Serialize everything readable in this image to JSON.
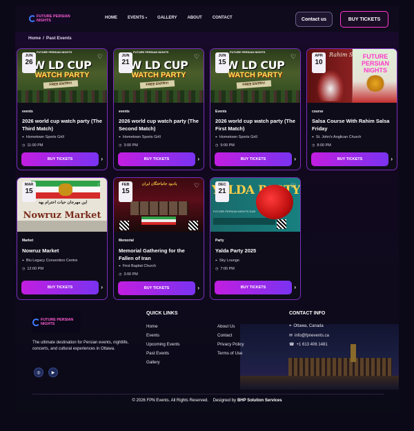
{
  "header": {
    "logo_text": "FUTURE PERSIAN NIGHTS",
    "nav": [
      {
        "label": "HOME",
        "active": false
      },
      {
        "label": "EVENTS",
        "active": true,
        "caret": "▾"
      },
      {
        "label": "GALLERY",
        "active": false
      },
      {
        "label": "ABOUT",
        "active": false
      },
      {
        "label": "CONTACT",
        "active": false
      }
    ],
    "contact_label": "Contact us",
    "buy_label": "BUY TICKETS"
  },
  "breadcrumb": {
    "home": "Home",
    "sep": "/",
    "current": "Past Events"
  },
  "events": [
    {
      "month": "JUN",
      "day": "26",
      "category": "events",
      "title": "2026 world cup watch party (The Third Match)",
      "venue": "Hometown Sports Grill",
      "time": "11:00 PM",
      "buy": "BUY TICKETS"
    },
    {
      "month": "JUN",
      "day": "21",
      "category": "events",
      "title": "2026 world cup watch party (The Second Match)",
      "venue": "Hometown Sports Grill",
      "time": "3:00 PM",
      "buy": "BUY TICKETS"
    },
    {
      "month": "JUN",
      "day": "15",
      "category": "Events",
      "title": "2026 world cup watch party (The First Match)",
      "venue": "Hometown Sports Grill",
      "time": "9:00 PM",
      "buy": "BUY TICKETS"
    },
    {
      "month": "APR",
      "day": "10",
      "category": "course",
      "title": "Salsa Course With Rahim Salsa Friday",
      "venue": "St. John's Anglican Church",
      "time": "8:00 PM",
      "buy": "BUY TICKETS"
    },
    {
      "month": "MAR",
      "day": "15",
      "category": "Market",
      "title": "Nowruz Market",
      "venue": "Blu Legacy Convention Centre",
      "time": "12:00 PM",
      "buy": "BUY TICKETS"
    },
    {
      "month": "FEB",
      "day": "15",
      "category": "Memorial",
      "title": "Memorial Gathering for the Fallen of Iran",
      "venue": "First Baptist Church",
      "time": "3:00 PM",
      "buy": "BUY TICKETS"
    },
    {
      "month": "DEC",
      "day": "21",
      "category": "Party",
      "title": "Yalda Party 2025",
      "venue": "Sky Lounge",
      "time": "7:00 PM",
      "buy": "BUY TICKETS"
    }
  ],
  "posters": {
    "wc_top": "FUTURE PERSIAN NIGHTS",
    "wc_big": "W LD CUP",
    "wc_watch": "WATCH PARTY",
    "wc_free": "FREE ENTRY!",
    "salsa_script": "Rahim Salsa Friday",
    "salsa_future": "FUTURE PERSIAN NIGHTS",
    "nowruz_fa": "این مهرجان حیات احترام بهه",
    "nowruz_name": "Nowruz Market",
    "mem_fa": "یادبود جانباختگان ایران",
    "yalda_title": "YALDA PARTY",
    "yalda_sub": "FUTURE PERSIAN NIGHTS 2025"
  },
  "footer": {
    "logo_text": "FUTURE PERSIAN NIGHTS",
    "description": "The ultimate destination for Persian events, nightlife, concerts, and cultural experiences in Ottawa.",
    "quick_links_title": "QUICK LINKS",
    "links_col1": [
      "Home",
      "Events",
      "Upcoming Events",
      "Past Events",
      "Gallery"
    ],
    "links_col2": [
      "About Us",
      "Contact",
      "Privacy Policy",
      "Terms of Use"
    ],
    "contact_title": "CONTACT INFO",
    "location": "Ottawa, Canada",
    "email": "info@fpnevents.ca",
    "phone": "+1 613 406 1481",
    "copyright": "© 2026 FPN Events. All Rights Reserved.",
    "designed_by": "Designed by",
    "designer": "BHP Solution Services"
  }
}
